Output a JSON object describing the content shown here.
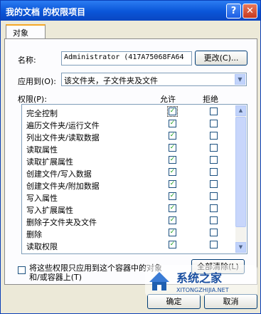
{
  "window": {
    "title": "我的文档 的权限项目",
    "help": "?",
    "close": "✕"
  },
  "tab": "对象",
  "name_label": "名称:",
  "name_value": "Administrator (417A75068FA64",
  "change_button": "更改(C)...",
  "apply_label": "应用到(O):",
  "apply_value": "该文件夹，子文件夹及文件",
  "perm_label": "权限(P):",
  "allow_header": "允许",
  "deny_header": "拒绝",
  "permissions": [
    {
      "name": "完全控制",
      "allow": true,
      "deny": false
    },
    {
      "name": "遍历文件夹/运行文件",
      "allow": true,
      "deny": false
    },
    {
      "name": "列出文件夹/读取数据",
      "allow": true,
      "deny": false
    },
    {
      "name": "读取属性",
      "allow": true,
      "deny": false
    },
    {
      "name": "读取扩展属性",
      "allow": true,
      "deny": false
    },
    {
      "name": "创建文件/写入数据",
      "allow": true,
      "deny": false
    },
    {
      "name": "创建文件夹/附加数据",
      "allow": true,
      "deny": false
    },
    {
      "name": "写入属性",
      "allow": true,
      "deny": false
    },
    {
      "name": "写入扩展属性",
      "allow": true,
      "deny": false
    },
    {
      "name": "删除子文件夹及文件",
      "allow": true,
      "deny": false
    },
    {
      "name": "删除",
      "allow": true,
      "deny": false
    },
    {
      "name": "读取权限",
      "allow": true,
      "deny": false
    }
  ],
  "apply_inherit_line1": "将这些权限只应用到这个容器中的对象",
  "apply_inherit_line2": "和/或容器上(T)",
  "clear_all_button": "全部清除(L)",
  "ok_button": "确定",
  "cancel_button": "取消",
  "watermark": {
    "brand": "系统之家",
    "url": "XITONGZHIJIA.NET"
  },
  "colors": {
    "check": "#21a121",
    "title_bar": "#0a55d8"
  }
}
